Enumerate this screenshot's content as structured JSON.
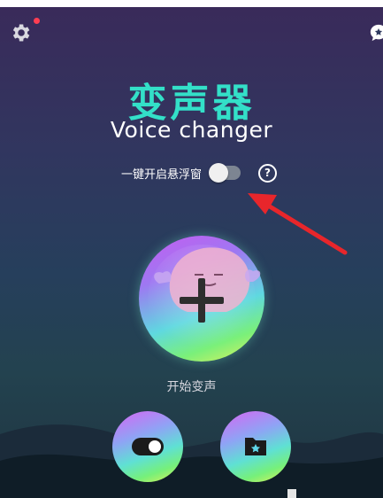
{
  "header": {
    "settings_icon": "gear-icon",
    "notification_dot_color": "#ff3e52",
    "right_icon": "star-chat-icon"
  },
  "title": {
    "chinese": "变声器",
    "english": "Voice changer",
    "accent_color": "#33e0c8"
  },
  "floating_window": {
    "label": "一键开启悬浮窗",
    "toggle_on": false,
    "help_label": "?"
  },
  "main_button": {
    "icon": "plus-icon",
    "label": "开始变声"
  },
  "bottom_buttons": [
    {
      "icon": "toggle-icon"
    },
    {
      "icon": "folder-star-icon"
    }
  ]
}
